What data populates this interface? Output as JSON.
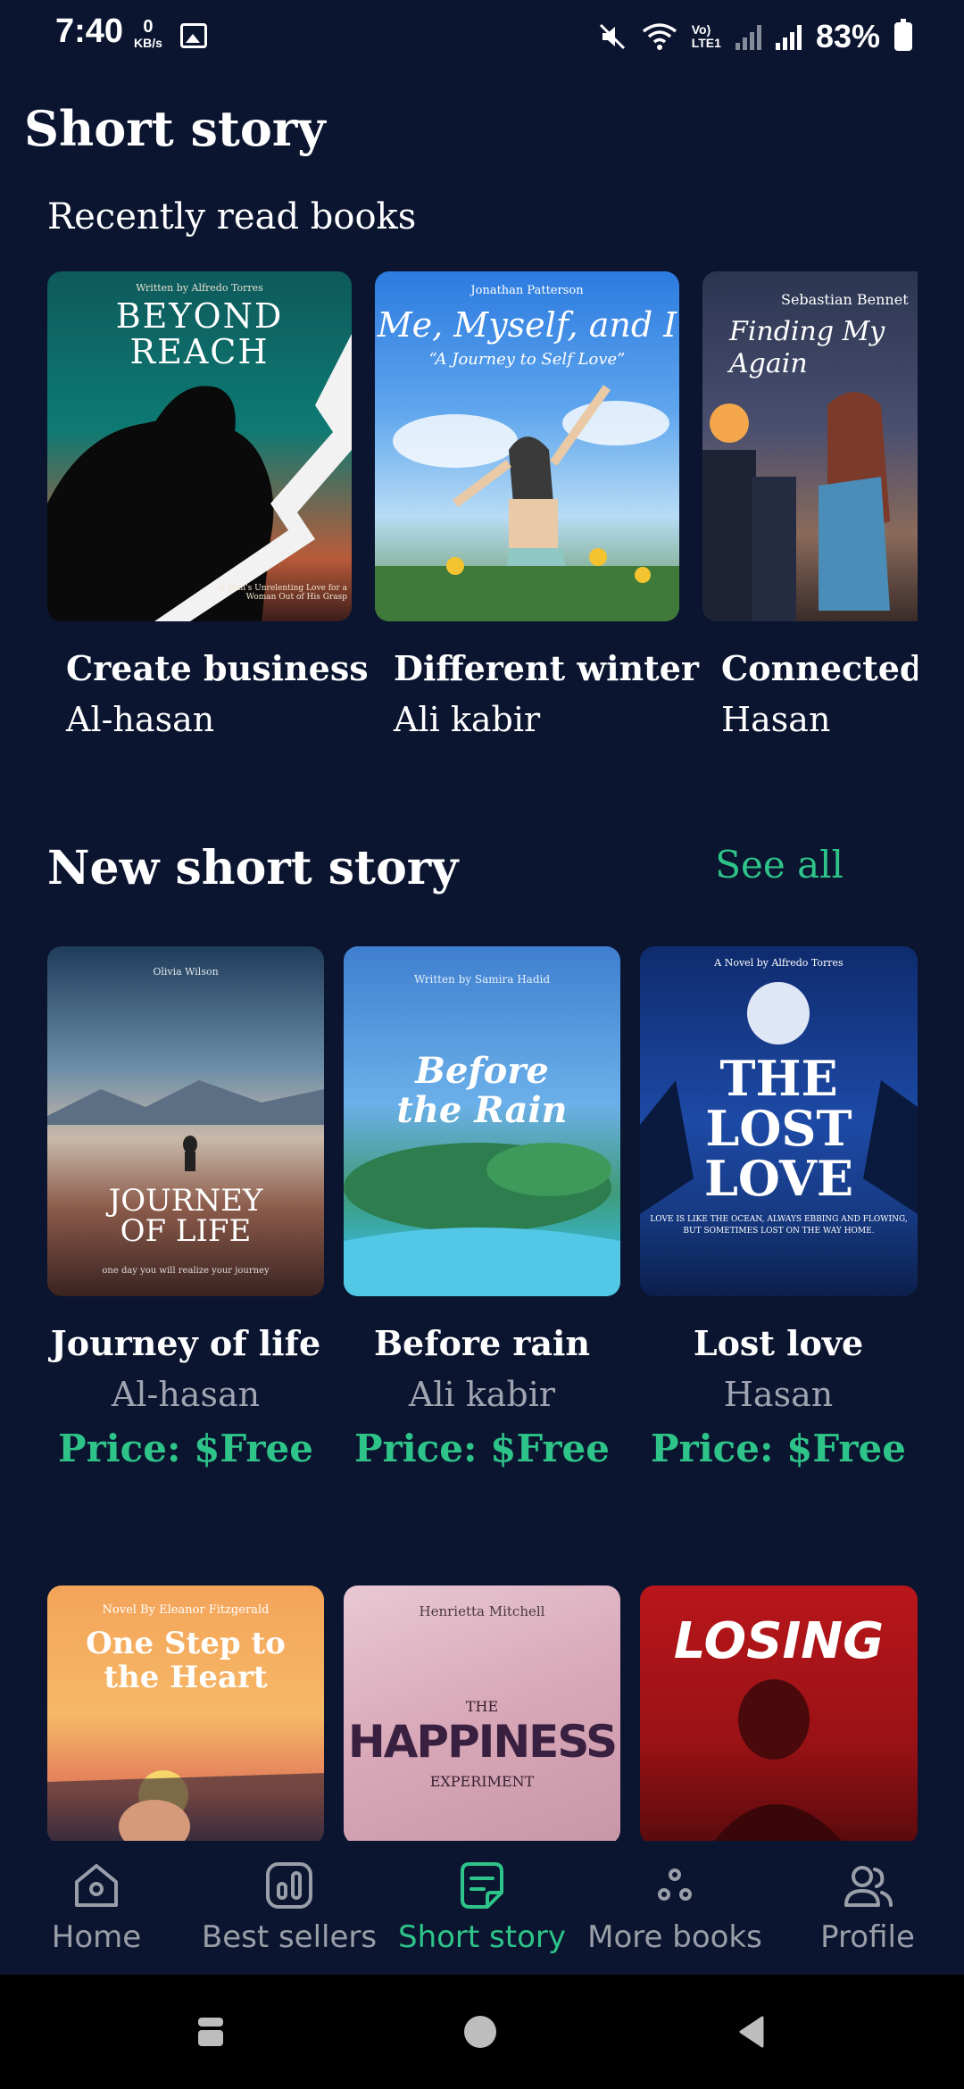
{
  "status_bar": {
    "time": "7:40",
    "net_speed_value": "0",
    "net_speed_unit": "KB/s",
    "lte_top": "Vo)",
    "lte_bottom": "LTE1",
    "battery": "83%"
  },
  "header": {
    "title": "Short story"
  },
  "recent": {
    "title": "Recently read books",
    "books": [
      {
        "title": "Create business",
        "author": "Al-hasan",
        "cover_author": "Written by Alfredo Torres",
        "cover_title": "BEYOND REACH",
        "cover_tagline": "A Man's Unrelenting Love for a Woman Out of His Grasp"
      },
      {
        "title": "Different winter",
        "author": "Ali kabir",
        "cover_author": "Jonathan Patterson",
        "cover_title": "Me, Myself, and I",
        "cover_tagline": "“A Journey to Self Love”"
      },
      {
        "title": "Connected w",
        "author": "Hasan",
        "cover_author": "Sebastian Bennet",
        "cover_title": "Finding My Again"
      }
    ]
  },
  "new_short": {
    "title": "New short story",
    "see_all": "See all",
    "books": [
      {
        "title": "Journey of life",
        "author": "Al-hasan",
        "price": "Price: $Free",
        "cover_author": "Olivia Wilson",
        "cover_title": "JOURNEY OF LIFE",
        "cover_tagline": "one day you will realize your journey"
      },
      {
        "title": "Before rain",
        "author": "Ali kabir",
        "price": "Price: $Free",
        "cover_author": "Written by Samira Hadid",
        "cover_title": "Before the Rain"
      },
      {
        "title": "Lost love",
        "author": "Hasan",
        "price": "Price: $Free",
        "cover_author": "A Novel by Alfredo Torres",
        "cover_title": "THE LOST LOVE",
        "cover_tagline": "LOVE IS LIKE THE OCEAN, ALWAYS EBBING AND FLOWING, BUT SOMETIMES LOST ON THE WAY HOME."
      }
    ],
    "more_covers": [
      {
        "cover_author": "Novel By Eleanor Fitzgerald",
        "cover_title": "One Step to the Heart"
      },
      {
        "cover_author": "Henrietta Mitchell",
        "cover_title_small": "THE",
        "cover_title": "HAPPINESS",
        "cover_sub": "EXPERIMENT"
      },
      {
        "cover_title": "LOSING"
      }
    ]
  },
  "nav": {
    "items": [
      {
        "label": "Home",
        "icon": "home-icon"
      },
      {
        "label": "Best sellers",
        "icon": "chart-icon"
      },
      {
        "label": "Short story",
        "icon": "document-icon"
      },
      {
        "label": "More books",
        "icon": "dots-icon"
      },
      {
        "label": "Profile",
        "icon": "users-icon"
      }
    ],
    "active": "Short story"
  },
  "colors": {
    "background": "#0b1530",
    "accent": "#2ec489",
    "muted": "#a0a4b0"
  }
}
